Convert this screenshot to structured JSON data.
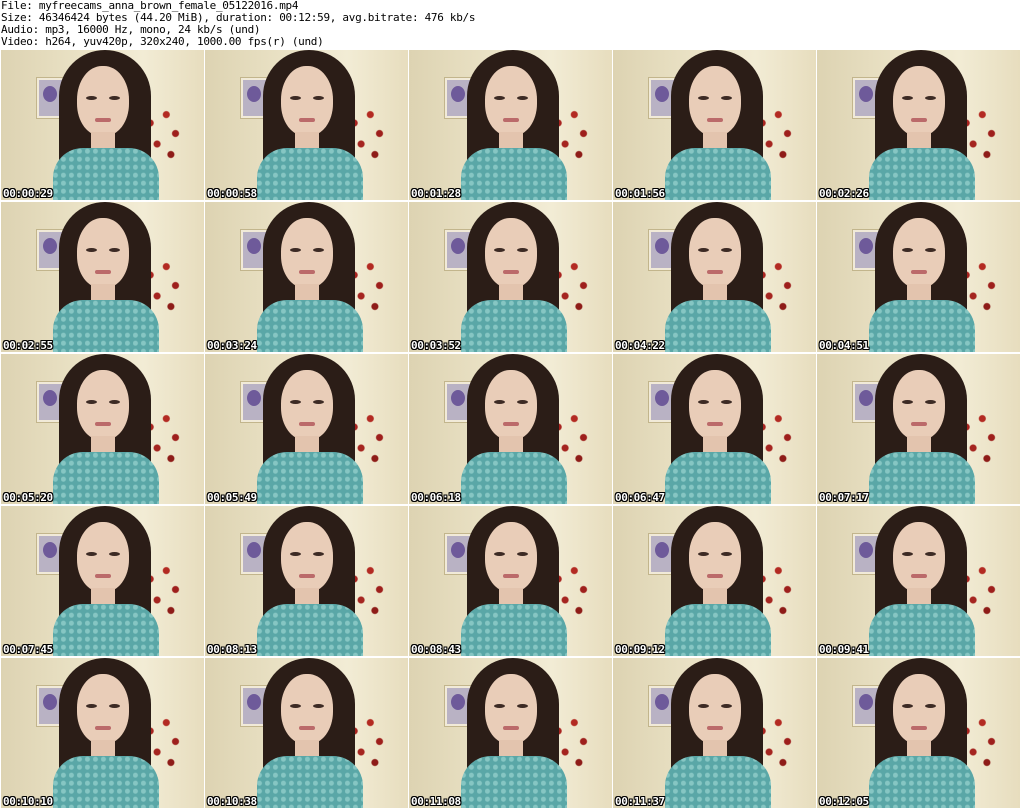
{
  "header": {
    "file_line": "File: myfreecams_anna_brown_female_05122016.mp4",
    "size_line": "Size: 46346424 bytes (44.20 MiB), duration: 00:12:59, avg.bitrate: 476 kb/s",
    "audio_line": "Audio: mp3, 16000 Hz, mono, 24 kb/s (und)",
    "video_line": "Video: h264, yuv420p, 320x240, 1000.00 fps(r) (und)"
  },
  "thumbnails": [
    {
      "timestamp": "00:00:29"
    },
    {
      "timestamp": "00:00:58"
    },
    {
      "timestamp": "00:01:28"
    },
    {
      "timestamp": "00:01:56"
    },
    {
      "timestamp": "00:02:26"
    },
    {
      "timestamp": "00:02:55"
    },
    {
      "timestamp": "00:03:24"
    },
    {
      "timestamp": "00:03:52"
    },
    {
      "timestamp": "00:04:22"
    },
    {
      "timestamp": "00:04:51"
    },
    {
      "timestamp": "00:05:20"
    },
    {
      "timestamp": "00:05:49"
    },
    {
      "timestamp": "00:06:18"
    },
    {
      "timestamp": "00:06:47"
    },
    {
      "timestamp": "00:07:17"
    },
    {
      "timestamp": "00:07:45"
    },
    {
      "timestamp": "00:08:13"
    },
    {
      "timestamp": "00:08:43"
    },
    {
      "timestamp": "00:09:12"
    },
    {
      "timestamp": "00:09:41"
    },
    {
      "timestamp": "00:10:10"
    },
    {
      "timestamp": "00:10:38"
    },
    {
      "timestamp": "00:11:08"
    },
    {
      "timestamp": "00:11:37"
    },
    {
      "timestamp": "00:12:05"
    }
  ]
}
